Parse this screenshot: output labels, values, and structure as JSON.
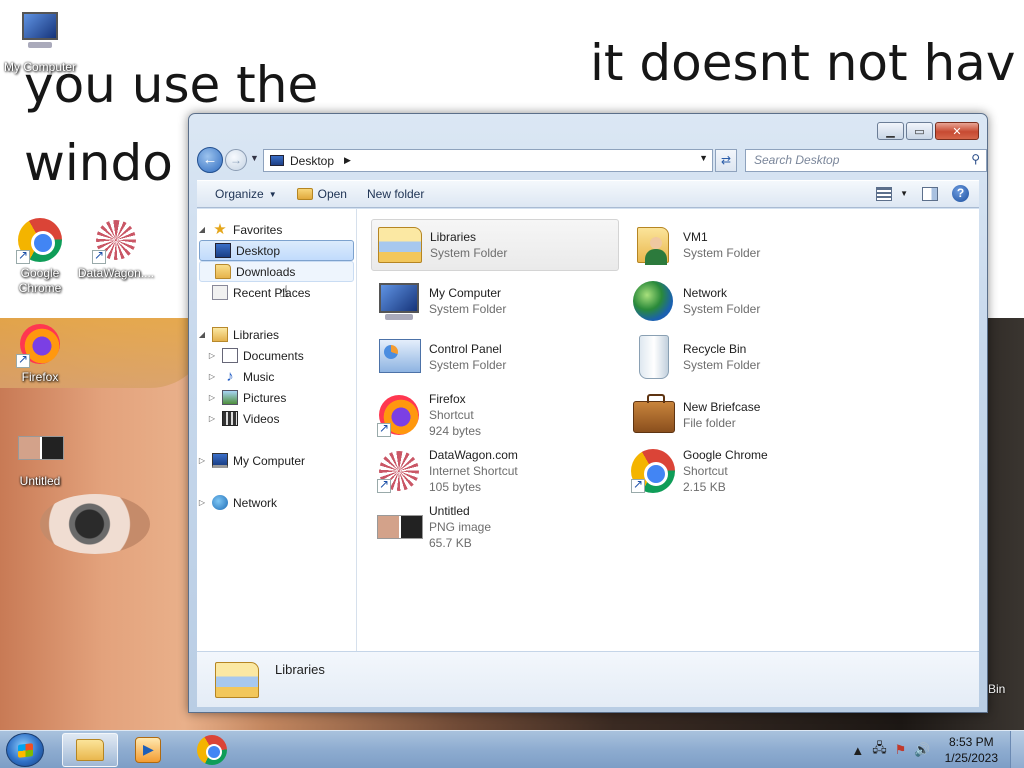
{
  "wallpaper": {
    "line1": "you use the",
    "line2": "windo",
    "line3": "it doesnt not hav"
  },
  "desktop_icons": {
    "my_computer": "My Computer",
    "chrome": "Google Chrome",
    "datawagon": "DataWagon....",
    "firefox": "Firefox",
    "untitled": "Untitled",
    "recycle_partial": "Bin"
  },
  "window": {
    "address": {
      "crumb": "Desktop",
      "search_placeholder": "Search Desktop"
    },
    "toolbar": {
      "organize": "Organize",
      "open": "Open",
      "new_folder": "New folder"
    },
    "nav": {
      "favorites": "Favorites",
      "desktop": "Desktop",
      "downloads": "Downloads",
      "recent_places": "Recent Places",
      "libraries": "Libraries",
      "documents": "Documents",
      "music": "Music",
      "pictures": "Pictures",
      "videos": "Videos",
      "my_computer": "My Computer",
      "network": "Network"
    },
    "items": [
      {
        "name": "Libraries",
        "line2": "System Folder",
        "line3": "",
        "icon": "libraries-icon"
      },
      {
        "name": "VM1",
        "line2": "System Folder",
        "line3": "",
        "icon": "user-folder-icon"
      },
      {
        "name": "My Computer",
        "line2": "System Folder",
        "line3": "",
        "icon": "computer-icon"
      },
      {
        "name": "Network",
        "line2": "System Folder",
        "line3": "",
        "icon": "network-icon"
      },
      {
        "name": "Control Panel",
        "line2": "System Folder",
        "line3": "",
        "icon": "control-panel-icon"
      },
      {
        "name": "Recycle Bin",
        "line2": "System Folder",
        "line3": "",
        "icon": "recycle-bin-icon"
      },
      {
        "name": "Firefox",
        "line2": "Shortcut",
        "line3": "924 bytes",
        "icon": "firefox-icon"
      },
      {
        "name": "New Briefcase",
        "line2": "File folder",
        "line3": "",
        "icon": "briefcase-icon"
      },
      {
        "name": "DataWagon.com",
        "line2": "Internet Shortcut",
        "line3": "105 bytes",
        "icon": "datawagon-icon"
      },
      {
        "name": "Google Chrome",
        "line2": "Shortcut",
        "line3": "2.15 KB",
        "icon": "chrome-icon"
      },
      {
        "name": "Untitled",
        "line2": "PNG image",
        "line3": "65.7 KB",
        "icon": "png-image-icon"
      }
    ],
    "details": {
      "name": "Libraries"
    }
  },
  "taskbar": {
    "time": "8:53 PM",
    "date": "1/25/2023"
  }
}
